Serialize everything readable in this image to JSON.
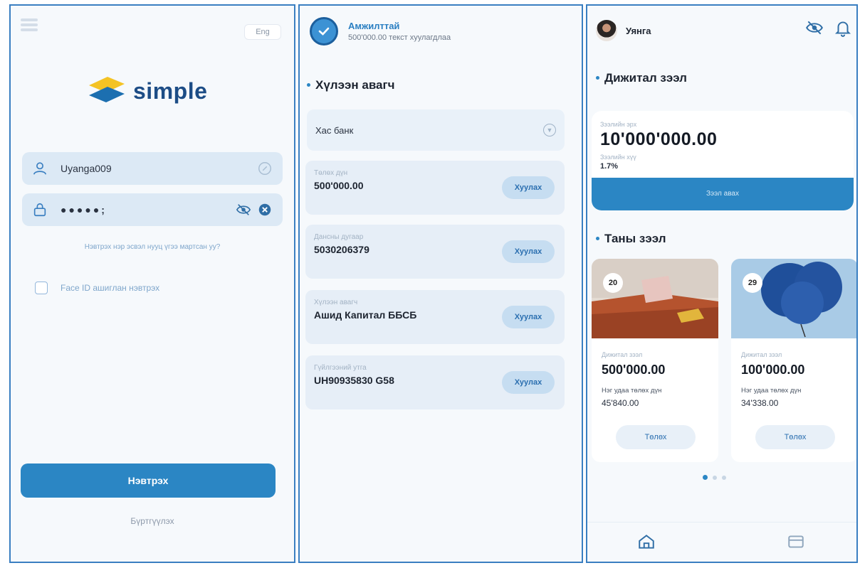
{
  "login": {
    "lang_button": "Eng",
    "logo_text": "simple",
    "username_value": "Uyanga009",
    "password_mask": "●●●●●;",
    "forgot_link": "Нэвтрэх нэр эсвэл нууц үгээ мартсан уу?",
    "faceid_label": "Face ID ашиглан нэвтрэх",
    "login_button": "Нэвтрэх",
    "register_link": "Бүртгүүлэх"
  },
  "transfer": {
    "success_title": "Амжилттай",
    "success_subtitle": "500'000.00 текст хуулагдлаа",
    "section_title": "Хүлээн авагч",
    "bank_label": "Хас банк",
    "copy_label": "Хуулах",
    "fields": [
      {
        "label": "Төлөх дүн",
        "value": "500'000.00"
      },
      {
        "label": "Дансны дугаар",
        "value": "5030206379"
      },
      {
        "label": "Хүлээн авагч",
        "value": "Ашид Капитал ББСБ"
      },
      {
        "label": "Гүйлгээний утга",
        "value": "UH90935830 G58"
      }
    ]
  },
  "loans": {
    "user_name": "Уянга",
    "digital_title": "Дижитал зээл",
    "limit_label": "Зээлийн эрх",
    "limit_amount": "10'000'000.00",
    "rate_label": "Зээлийн хүү",
    "rate_value": "1.7%",
    "take_loan_button": "Зээл авах",
    "your_loans_title": "Таны зээл",
    "cards": [
      {
        "badge": "20",
        "label": "Дижитал зээл",
        "amount": "500'000.00",
        "sub_label": "Нэг удаа төлөх дүн",
        "sub_value": "45'840.00",
        "pay_button": "Төлөх"
      },
      {
        "badge": "29",
        "label": "Дижитал зээл",
        "amount": "100'000.00",
        "sub_label": "Нэг удаа төлөх дүн",
        "sub_value": "34'338.00",
        "pay_button": "Төлөх"
      }
    ],
    "pager": {
      "count": 3,
      "active": 1
    }
  },
  "colors": {
    "accent": "#2b86c4",
    "frame": "#3a7fc1",
    "background": "#f6f9fc"
  }
}
